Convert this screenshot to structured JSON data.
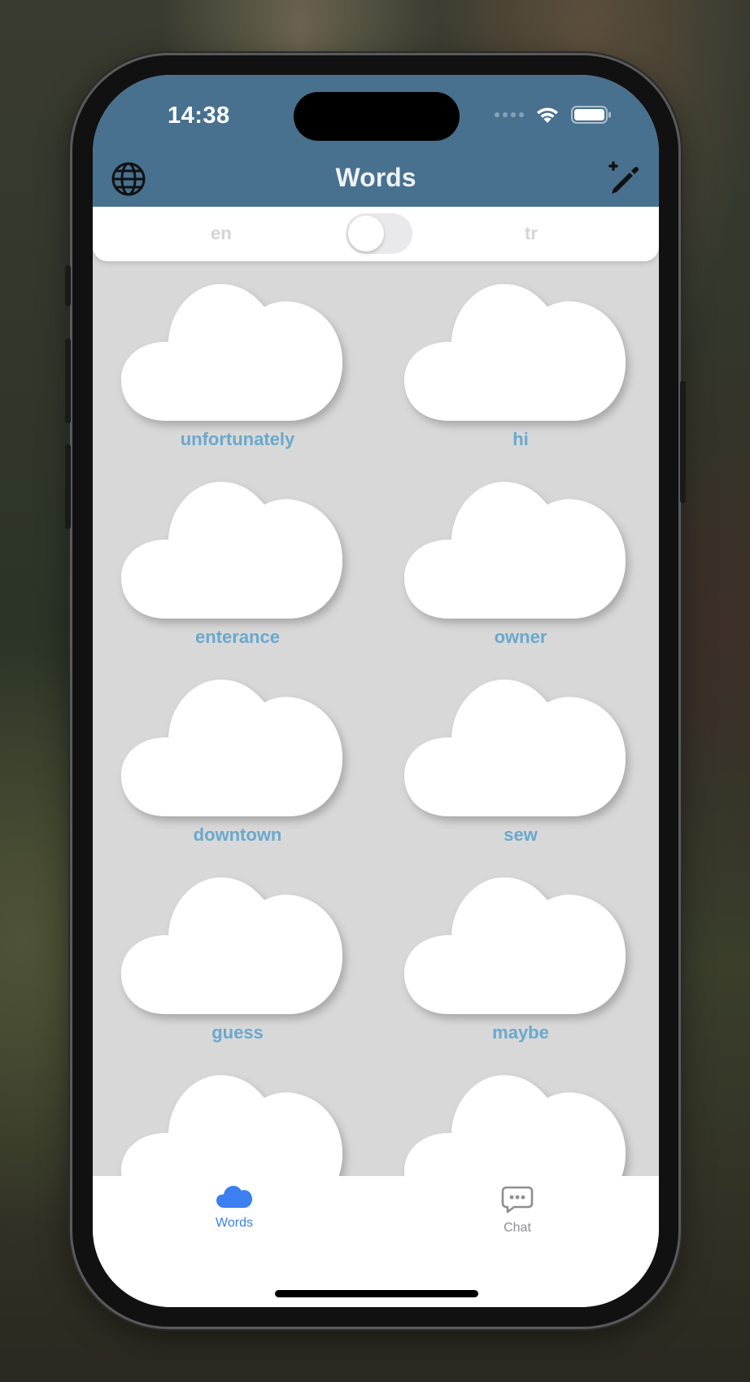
{
  "status_bar": {
    "time": "14:38",
    "icons": [
      "signal-dots-icon",
      "wifi-icon",
      "battery-icon"
    ]
  },
  "nav": {
    "title": "Words",
    "left_icon": "globe-icon",
    "right_icon": "edit-add-icon"
  },
  "language_toggle": {
    "left_label": "en",
    "right_label": "tr",
    "is_on": false
  },
  "words": [
    "unfortunately",
    "hi",
    "enterance",
    "owner",
    "downtown",
    "sew",
    "guess",
    "maybe",
    "",
    ""
  ],
  "tabbar": {
    "items": [
      {
        "label": "Words",
        "icon": "cloud-icon",
        "active": true
      },
      {
        "label": "Chat",
        "icon": "chat-bubble-icon",
        "active": false
      }
    ]
  },
  "colors": {
    "header": "#48718f",
    "word_text": "#6aa8cc",
    "tab_active": "#3b7ff0",
    "tab_inactive": "#8e8e93",
    "background": "#d8d8d8"
  }
}
